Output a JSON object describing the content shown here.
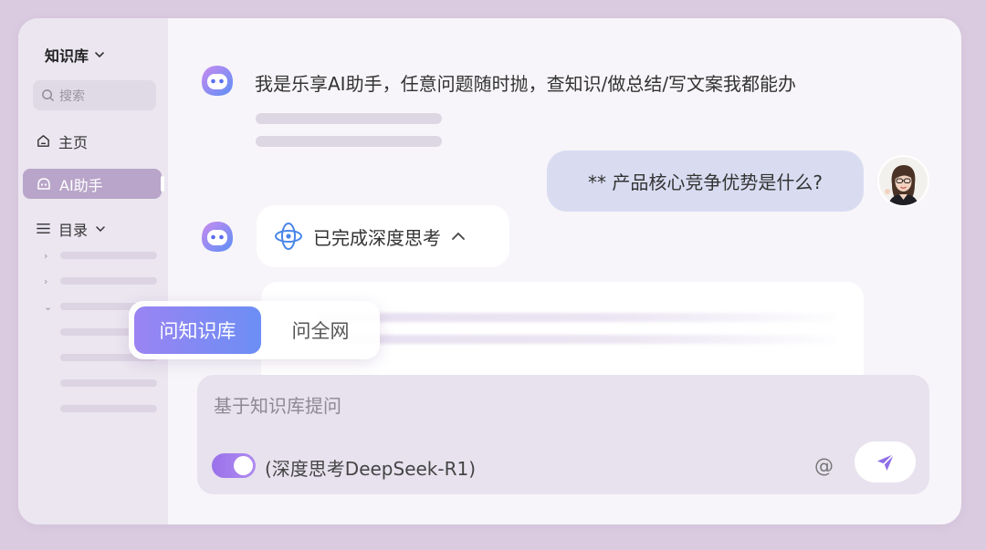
{
  "sidebar": {
    "kb_title": "知识库",
    "search_placeholder": "搜索",
    "items": [
      {
        "label": "主页"
      },
      {
        "label": "AI助手"
      },
      {
        "label": "目录"
      }
    ]
  },
  "chat": {
    "greeting": "我是乐享AI助手，任意问题随时抛，查知识/做总结/写文案我都能办",
    "user_question": "** 产品核心竞争优势是什么?",
    "thinking_status": "已完成深度思考"
  },
  "scope_selector": {
    "options": [
      {
        "label": "问知识库",
        "selected": true
      },
      {
        "label": "问全网",
        "selected": false
      }
    ]
  },
  "composer": {
    "placeholder": "基于知识库提问",
    "deep_think_enabled": true,
    "deep_think_label": "(深度思考DeepSeek-R1)",
    "mention_symbol": "@"
  },
  "colors": {
    "background": "#dacbe0",
    "accent_purple": "#9a72ea",
    "active_nav": "#b9a5c9",
    "user_bubble": "#d9dcf1"
  }
}
